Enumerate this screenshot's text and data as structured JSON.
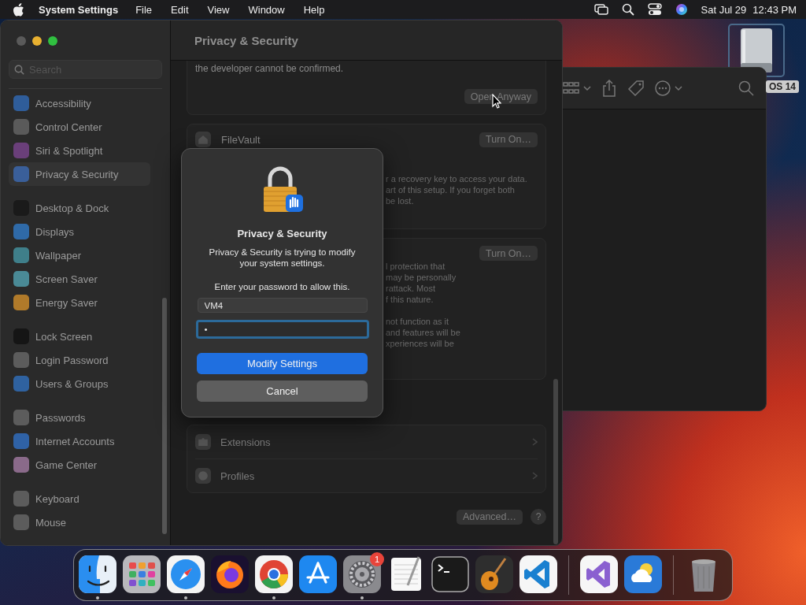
{
  "menu_bar": {
    "app_name": "System Settings",
    "menus": [
      "File",
      "Edit",
      "View",
      "Window",
      "Help"
    ],
    "date": "Sat Jul 29",
    "time": "12:43 PM"
  },
  "desktop": {
    "disk_label": "OS 14"
  },
  "settings_window": {
    "search": {
      "placeholder": "Search"
    },
    "sidebar": {
      "groups": [
        [
          {
            "label": "Accessibility",
            "color": "#2f5d9a",
            "selected": false
          },
          {
            "label": "Control Center",
            "color": "#5a5a5a",
            "selected": false
          },
          {
            "label": "Siri & Spotlight",
            "color": "#6a3f7a",
            "selected": false
          },
          {
            "label": "Privacy & Security",
            "color": "#3a5f9a",
            "selected": true
          }
        ],
        [
          {
            "label": "Desktop & Dock",
            "color": "#1a1a1a",
            "selected": false
          },
          {
            "label": "Displays",
            "color": "#2f6aa8",
            "selected": false
          },
          {
            "label": "Wallpaper",
            "color": "#3f7f8a",
            "selected": false
          },
          {
            "label": "Screen Saver",
            "color": "#4a8a96",
            "selected": false
          },
          {
            "label": "Energy Saver",
            "color": "#b07a2a",
            "selected": false
          }
        ],
        [
          {
            "label": "Lock Screen",
            "color": "#151515",
            "selected": false
          },
          {
            "label": "Login Password",
            "color": "#5c5c5c",
            "selected": false
          },
          {
            "label": "Users & Groups",
            "color": "#2f62a0",
            "selected": false
          }
        ],
        [
          {
            "label": "Passwords",
            "color": "#5c5c5c",
            "selected": false
          },
          {
            "label": "Internet Accounts",
            "color": "#2f62a6",
            "selected": false
          },
          {
            "label": "Game Center",
            "color": "#8a6a8a",
            "selected": false
          }
        ],
        [
          {
            "label": "Keyboard",
            "color": "#5c5c5c",
            "selected": false
          },
          {
            "label": "Mouse",
            "color": "#5c5c5c",
            "selected": false
          }
        ]
      ]
    },
    "title": "Privacy & Security",
    "cards": [
      {
        "kind": "notice",
        "text": "the developer cannot be confirmed.",
        "button": "Open Anyway"
      },
      {
        "kind": "feature",
        "title": "FileVault",
        "button": "Turn On…",
        "lines": [
          "r a recovery key to access your data.",
          "art of this setup. If you forget both",
          "be lost."
        ]
      },
      {
        "kind": "feature",
        "button": "Turn On…",
        "lines": [
          "l protection that",
          "may be personally",
          "rattack. Most",
          "f this nature.",
          "not function as it",
          "and features will be",
          "xperiences will be"
        ]
      },
      {
        "kind": "list",
        "rows": [
          "Extensions",
          "Profiles"
        ]
      }
    ],
    "advanced_button": "Advanced…",
    "help_button": "?"
  },
  "dialog": {
    "title": "Privacy & Security",
    "message": "Privacy & Security is trying to modify your system settings.",
    "prompt": "Enter your password to allow this.",
    "username": {
      "value": "VM4",
      "focused": false
    },
    "password": {
      "value": "•",
      "focused": true
    },
    "buttons": [
      {
        "label": "Modify Settings",
        "kind": "primary"
      },
      {
        "label": "Cancel",
        "kind": "secondary"
      }
    ]
  },
  "dock": {
    "apps": [
      {
        "kind": "finder",
        "running": true
      },
      {
        "kind": "launchpad",
        "running": false
      },
      {
        "kind": "safari",
        "running": true
      },
      {
        "kind": "firefox",
        "running": false
      },
      {
        "kind": "chrome",
        "running": true
      },
      {
        "kind": "appstore",
        "running": false
      },
      {
        "kind": "settings",
        "running": true,
        "badge": "1"
      },
      {
        "kind": "textedit",
        "running": false
      },
      {
        "kind": "terminal",
        "running": false
      },
      {
        "kind": "garageband",
        "running": false
      },
      {
        "kind": "vscode",
        "running": false
      },
      {
        "kind": "separator"
      },
      {
        "kind": "visualstudio",
        "running": false
      },
      {
        "kind": "weather",
        "running": false
      },
      {
        "kind": "separator"
      },
      {
        "kind": "trash",
        "running": false
      }
    ]
  }
}
